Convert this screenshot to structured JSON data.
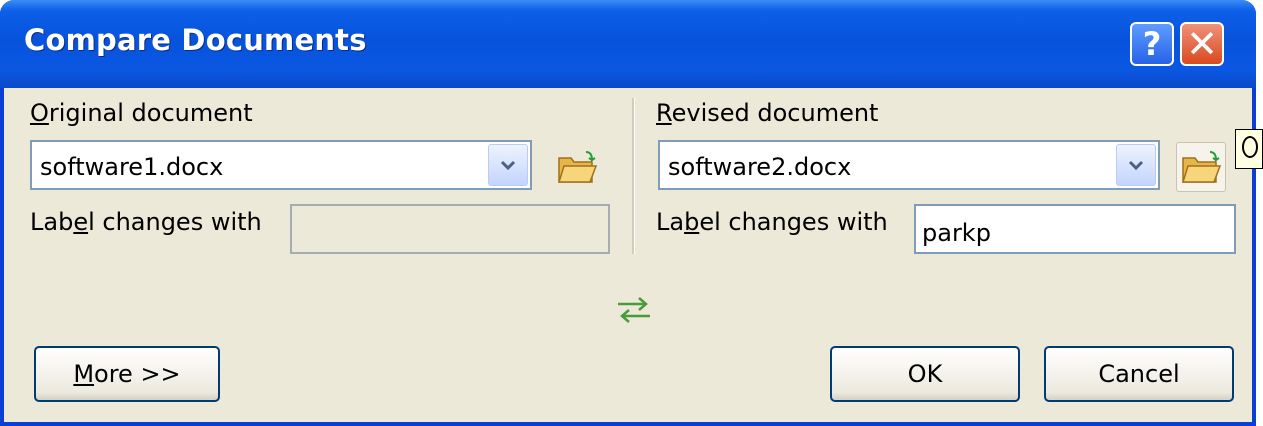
{
  "window": {
    "title": "Compare Documents",
    "help_label": "?",
    "close_label": "✕"
  },
  "original": {
    "heading_first": "O",
    "heading_rest": "riginal document",
    "file_value": "software1.docx",
    "label_changes_pre": "Lab",
    "label_changes_mnemonic": "e",
    "label_changes_post": "l changes with",
    "label_value": ""
  },
  "revised": {
    "heading_first": "R",
    "heading_rest": "evised document",
    "file_value": "software2.docx",
    "label_changes_pre": "La",
    "label_changes_mnemonic": "b",
    "label_changes_post": "el changes with",
    "label_value": "parkp"
  },
  "buttons": {
    "more_mnemonic": "M",
    "more_rest": "ore >>",
    "ok": "OK",
    "cancel": "Cancel"
  },
  "icons": {
    "browse": "open-folder-icon",
    "swap": "swap-arrows-icon",
    "dropdown": "chevron-down-icon"
  },
  "colors": {
    "titlebar": "#0753dc",
    "dialog_bg": "#ece9d8",
    "close": "#d9491e"
  }
}
